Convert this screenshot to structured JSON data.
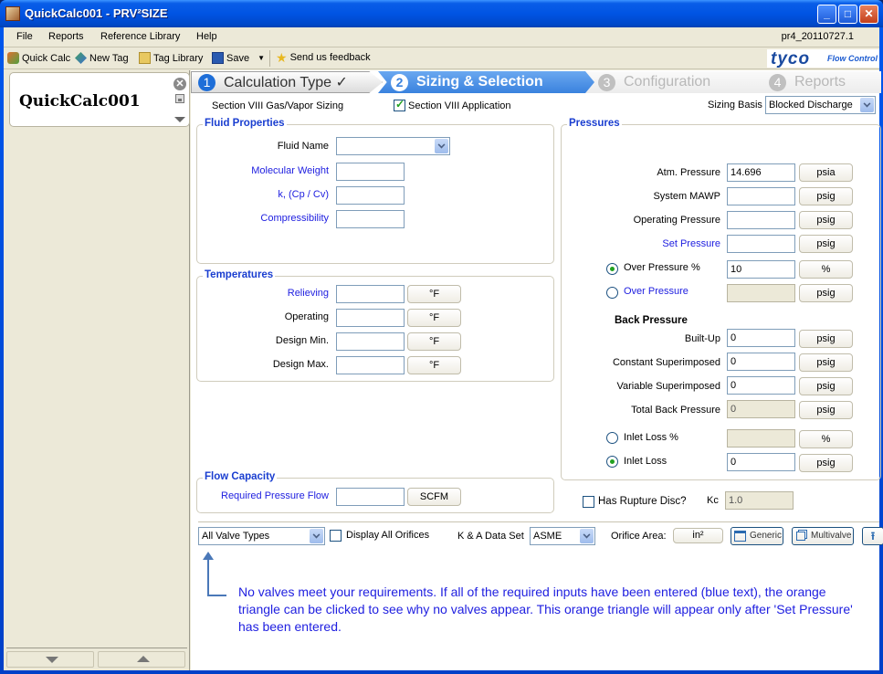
{
  "window": {
    "title": "QuickCalc001 - PRV²SIZE",
    "minimize": "_",
    "maximize": "□",
    "close": "✕"
  },
  "menu": {
    "items": [
      "File",
      "Reports",
      "Reference Library",
      "Help"
    ],
    "version": "pr4_20110727.1"
  },
  "toolbar": {
    "quick_calc": "Quick Calc",
    "new_tag": "New Tag",
    "tag_library": "Tag Library",
    "save": "Save",
    "feedback": "Send us feedback"
  },
  "brand": {
    "name": "tyco",
    "tagline": "Flow Control"
  },
  "sidebar": {
    "tag_name": "QuickCalc001",
    "close_glyph": "✕"
  },
  "steps": [
    {
      "num": "1",
      "label": "Calculation Type ✓",
      "state": "done"
    },
    {
      "num": "2",
      "label": "Sizing & Selection",
      "state": "active"
    },
    {
      "num": "3",
      "label": "Configuration",
      "state": "disabled"
    },
    {
      "num": "4",
      "label": "Reports",
      "state": "disabled"
    }
  ],
  "header": {
    "sizing_type": "Section VIII Gas/Vapor Sizing",
    "section_app_label": "Section VIII Application",
    "section_app_checked": true,
    "sizing_basis_label": "Sizing Basis",
    "sizing_basis_value": "Blocked Discharge"
  },
  "fluid": {
    "title": "Fluid Properties",
    "fluid_name_label": "Fluid Name",
    "fluid_name_value": "",
    "mol_weight_label": "Molecular Weight",
    "k_label": "k, (Cp / Cv)",
    "compress_label": "Compressibility"
  },
  "temps": {
    "title": "Temperatures",
    "rows": [
      {
        "label": "Relieving",
        "value": "",
        "unit": "°F",
        "required": true
      },
      {
        "label": "Operating",
        "value": "",
        "unit": "°F",
        "required": false
      },
      {
        "label": "Design Min.",
        "value": "",
        "unit": "°F",
        "required": false
      },
      {
        "label": "Design Max.",
        "value": "",
        "unit": "°F",
        "required": false
      }
    ]
  },
  "flow": {
    "title": "Flow Capacity",
    "label": "Required Pressure Flow",
    "value": "",
    "unit": "SCFM"
  },
  "pressures": {
    "title": "Pressures",
    "atm_label": "Atm. Pressure",
    "atm_value": "14.696",
    "atm_unit": "psia",
    "mawp_label": "System MAWP",
    "mawp_unit": "psig",
    "op_label": "Operating Pressure",
    "op_unit": "psig",
    "set_label": "Set Pressure",
    "set_unit": "psig",
    "op_pct_label": "Over Pressure %",
    "op_pct_value": "10",
    "op_pct_unit": "%",
    "over_label": "Over Pressure",
    "over_unit": "psig",
    "back_title": "Back Pressure",
    "builtup_label": "Built-Up",
    "builtup_value": "0",
    "builtup_unit": "psig",
    "const_label": "Constant Superimposed",
    "const_value": "0",
    "const_unit": "psig",
    "var_label": "Variable Superimposed",
    "var_value": "0",
    "var_unit": "psig",
    "total_label": "Total Back Pressure",
    "total_value": "0",
    "total_unit": "psig",
    "inlet_pct_label": "Inlet Loss %",
    "inlet_pct_unit": "%",
    "inlet_label": "Inlet Loss",
    "inlet_value": "0",
    "inlet_unit": "psig"
  },
  "rupture": {
    "label": "Has Rupture Disc?",
    "checked": false,
    "kc_label": "Kc",
    "kc_value": "1.0"
  },
  "selection": {
    "valve_types": "All Valve Types",
    "display_all_label": "Display All Orifices",
    "ka_label": "K & A Data Set",
    "ka_value": "ASME",
    "orifice_label": "Orifice Area:",
    "orifice_unit": "in²",
    "generic": "Generic",
    "multivalve": "Multivalve"
  },
  "message": "No valves meet your requirements.  If all of the required inputs have been entered (blue text), the orange triangle can be clicked to see why no valves appear.  This orange triangle will appear only after 'Set Pressure' has been entered."
}
